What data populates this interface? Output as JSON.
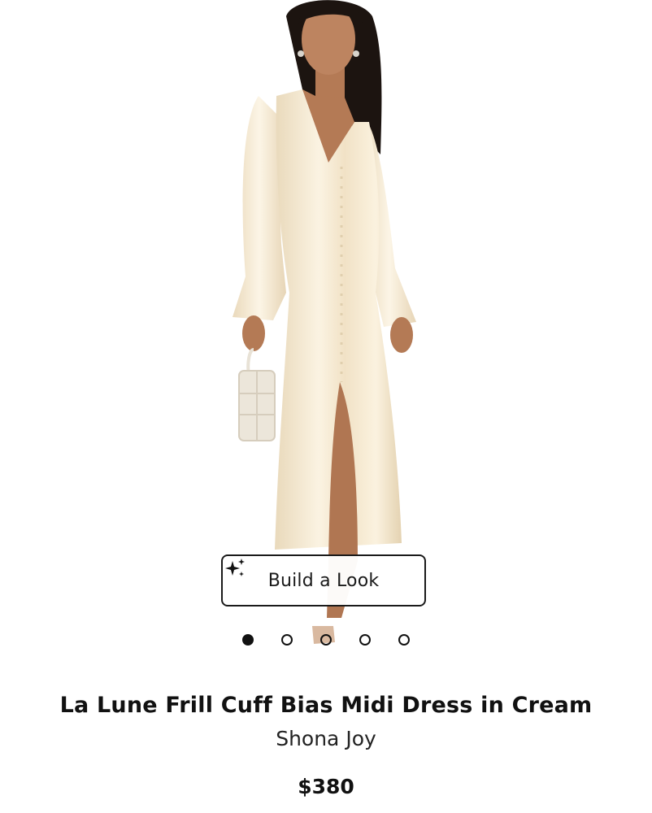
{
  "product": {
    "title": "La Lune Frill Cuff Bias Midi Dress in Cream",
    "brand": "Shona Joy",
    "price": "$380"
  },
  "gallery": {
    "image_icon": "product-photo",
    "build_look_label": "Build a Look",
    "build_look_icon": "sparkle-icon",
    "dot_count": 5,
    "active_index": 0
  },
  "colors": {
    "dress": "#f3e6cd",
    "skin": "#b47a55",
    "hair": "#1c1410",
    "accent": "#111111"
  }
}
